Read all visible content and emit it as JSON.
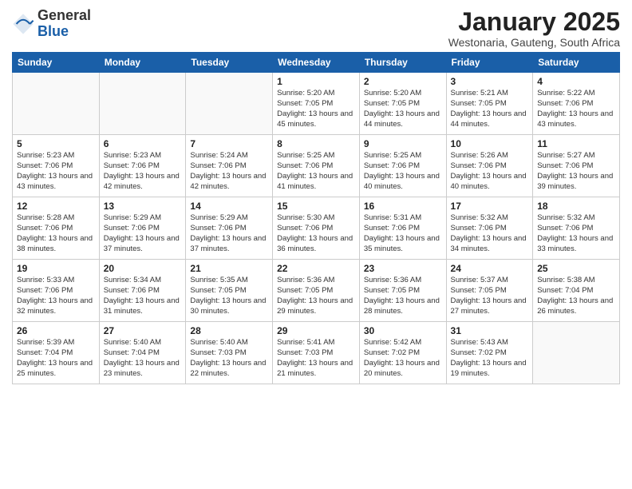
{
  "logo": {
    "general": "General",
    "blue": "Blue"
  },
  "title": "January 2025",
  "location": "Westonaria, Gauteng, South Africa",
  "days_of_week": [
    "Sunday",
    "Monday",
    "Tuesday",
    "Wednesday",
    "Thursday",
    "Friday",
    "Saturday"
  ],
  "weeks": [
    [
      {
        "day": "",
        "sunrise": "",
        "sunset": "",
        "daylight": ""
      },
      {
        "day": "",
        "sunrise": "",
        "sunset": "",
        "daylight": ""
      },
      {
        "day": "",
        "sunrise": "",
        "sunset": "",
        "daylight": ""
      },
      {
        "day": "1",
        "sunrise": "Sunrise: 5:20 AM",
        "sunset": "Sunset: 7:05 PM",
        "daylight": "Daylight: 13 hours and 45 minutes."
      },
      {
        "day": "2",
        "sunrise": "Sunrise: 5:20 AM",
        "sunset": "Sunset: 7:05 PM",
        "daylight": "Daylight: 13 hours and 44 minutes."
      },
      {
        "day": "3",
        "sunrise": "Sunrise: 5:21 AM",
        "sunset": "Sunset: 7:05 PM",
        "daylight": "Daylight: 13 hours and 44 minutes."
      },
      {
        "day": "4",
        "sunrise": "Sunrise: 5:22 AM",
        "sunset": "Sunset: 7:06 PM",
        "daylight": "Daylight: 13 hours and 43 minutes."
      }
    ],
    [
      {
        "day": "5",
        "sunrise": "Sunrise: 5:23 AM",
        "sunset": "Sunset: 7:06 PM",
        "daylight": "Daylight: 13 hours and 43 minutes."
      },
      {
        "day": "6",
        "sunrise": "Sunrise: 5:23 AM",
        "sunset": "Sunset: 7:06 PM",
        "daylight": "Daylight: 13 hours and 42 minutes."
      },
      {
        "day": "7",
        "sunrise": "Sunrise: 5:24 AM",
        "sunset": "Sunset: 7:06 PM",
        "daylight": "Daylight: 13 hours and 42 minutes."
      },
      {
        "day": "8",
        "sunrise": "Sunrise: 5:25 AM",
        "sunset": "Sunset: 7:06 PM",
        "daylight": "Daylight: 13 hours and 41 minutes."
      },
      {
        "day": "9",
        "sunrise": "Sunrise: 5:25 AM",
        "sunset": "Sunset: 7:06 PM",
        "daylight": "Daylight: 13 hours and 40 minutes."
      },
      {
        "day": "10",
        "sunrise": "Sunrise: 5:26 AM",
        "sunset": "Sunset: 7:06 PM",
        "daylight": "Daylight: 13 hours and 40 minutes."
      },
      {
        "day": "11",
        "sunrise": "Sunrise: 5:27 AM",
        "sunset": "Sunset: 7:06 PM",
        "daylight": "Daylight: 13 hours and 39 minutes."
      }
    ],
    [
      {
        "day": "12",
        "sunrise": "Sunrise: 5:28 AM",
        "sunset": "Sunset: 7:06 PM",
        "daylight": "Daylight: 13 hours and 38 minutes."
      },
      {
        "day": "13",
        "sunrise": "Sunrise: 5:29 AM",
        "sunset": "Sunset: 7:06 PM",
        "daylight": "Daylight: 13 hours and 37 minutes."
      },
      {
        "day": "14",
        "sunrise": "Sunrise: 5:29 AM",
        "sunset": "Sunset: 7:06 PM",
        "daylight": "Daylight: 13 hours and 37 minutes."
      },
      {
        "day": "15",
        "sunrise": "Sunrise: 5:30 AM",
        "sunset": "Sunset: 7:06 PM",
        "daylight": "Daylight: 13 hours and 36 minutes."
      },
      {
        "day": "16",
        "sunrise": "Sunrise: 5:31 AM",
        "sunset": "Sunset: 7:06 PM",
        "daylight": "Daylight: 13 hours and 35 minutes."
      },
      {
        "day": "17",
        "sunrise": "Sunrise: 5:32 AM",
        "sunset": "Sunset: 7:06 PM",
        "daylight": "Daylight: 13 hours and 34 minutes."
      },
      {
        "day": "18",
        "sunrise": "Sunrise: 5:32 AM",
        "sunset": "Sunset: 7:06 PM",
        "daylight": "Daylight: 13 hours and 33 minutes."
      }
    ],
    [
      {
        "day": "19",
        "sunrise": "Sunrise: 5:33 AM",
        "sunset": "Sunset: 7:06 PM",
        "daylight": "Daylight: 13 hours and 32 minutes."
      },
      {
        "day": "20",
        "sunrise": "Sunrise: 5:34 AM",
        "sunset": "Sunset: 7:06 PM",
        "daylight": "Daylight: 13 hours and 31 minutes."
      },
      {
        "day": "21",
        "sunrise": "Sunrise: 5:35 AM",
        "sunset": "Sunset: 7:05 PM",
        "daylight": "Daylight: 13 hours and 30 minutes."
      },
      {
        "day": "22",
        "sunrise": "Sunrise: 5:36 AM",
        "sunset": "Sunset: 7:05 PM",
        "daylight": "Daylight: 13 hours and 29 minutes."
      },
      {
        "day": "23",
        "sunrise": "Sunrise: 5:36 AM",
        "sunset": "Sunset: 7:05 PM",
        "daylight": "Daylight: 13 hours and 28 minutes."
      },
      {
        "day": "24",
        "sunrise": "Sunrise: 5:37 AM",
        "sunset": "Sunset: 7:05 PM",
        "daylight": "Daylight: 13 hours and 27 minutes."
      },
      {
        "day": "25",
        "sunrise": "Sunrise: 5:38 AM",
        "sunset": "Sunset: 7:04 PM",
        "daylight": "Daylight: 13 hours and 26 minutes."
      }
    ],
    [
      {
        "day": "26",
        "sunrise": "Sunrise: 5:39 AM",
        "sunset": "Sunset: 7:04 PM",
        "daylight": "Daylight: 13 hours and 25 minutes."
      },
      {
        "day": "27",
        "sunrise": "Sunrise: 5:40 AM",
        "sunset": "Sunset: 7:04 PM",
        "daylight": "Daylight: 13 hours and 23 minutes."
      },
      {
        "day": "28",
        "sunrise": "Sunrise: 5:40 AM",
        "sunset": "Sunset: 7:03 PM",
        "daylight": "Daylight: 13 hours and 22 minutes."
      },
      {
        "day": "29",
        "sunrise": "Sunrise: 5:41 AM",
        "sunset": "Sunset: 7:03 PM",
        "daylight": "Daylight: 13 hours and 21 minutes."
      },
      {
        "day": "30",
        "sunrise": "Sunrise: 5:42 AM",
        "sunset": "Sunset: 7:02 PM",
        "daylight": "Daylight: 13 hours and 20 minutes."
      },
      {
        "day": "31",
        "sunrise": "Sunrise: 5:43 AM",
        "sunset": "Sunset: 7:02 PM",
        "daylight": "Daylight: 13 hours and 19 minutes."
      },
      {
        "day": "",
        "sunrise": "",
        "sunset": "",
        "daylight": ""
      }
    ]
  ]
}
